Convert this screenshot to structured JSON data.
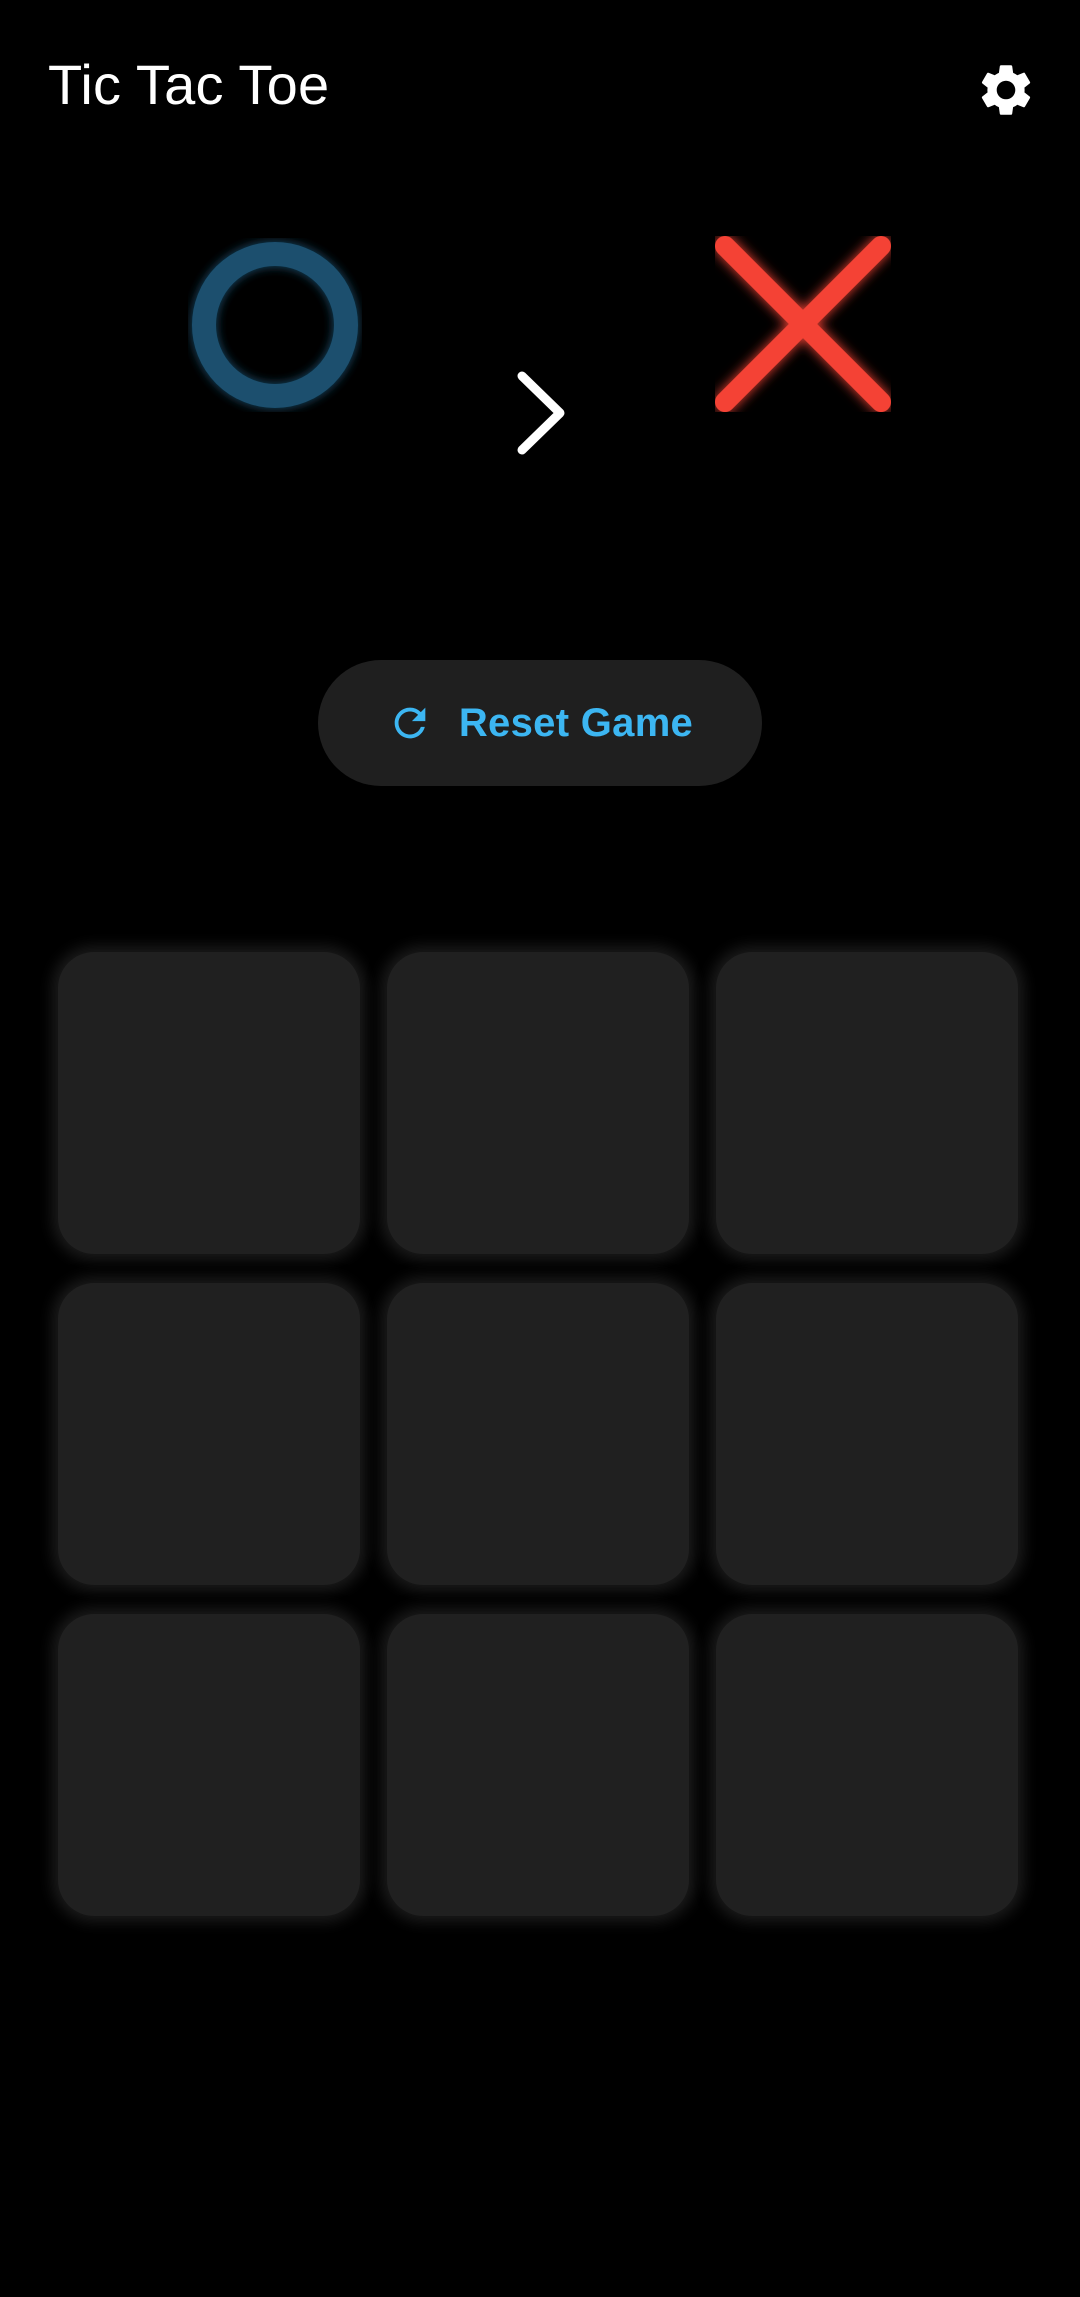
{
  "app": {
    "title": "Tic Tac Toe"
  },
  "header": {
    "settings_icon": "gear-icon"
  },
  "players": {
    "o": {
      "symbol": "O",
      "color": "#1a4f6e"
    },
    "x": {
      "symbol": "X",
      "color": "#f44336"
    },
    "current_turn": "X",
    "turn_icon": "chevron-right-icon"
  },
  "reset_button": {
    "label": "Reset Game",
    "icon": "refresh-icon",
    "color": "#3cb6f2"
  },
  "board": {
    "cells": [
      "",
      "",
      "",
      "",
      "",
      "",
      "",
      "",
      ""
    ]
  }
}
